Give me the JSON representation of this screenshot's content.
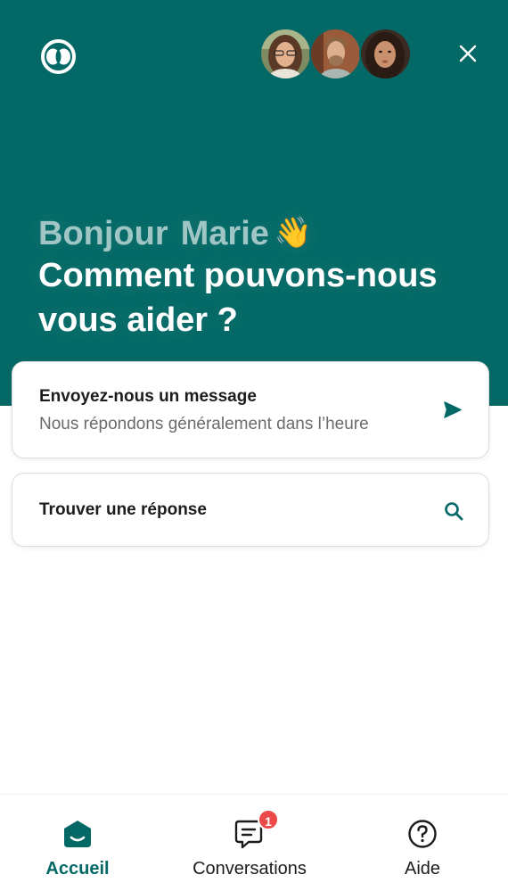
{
  "colors": {
    "brand": "#046966",
    "greeting": "#9fc6c4",
    "badge": "#ec4949"
  },
  "header": {
    "logo_icon": "brand-logo-icon",
    "avatars": [
      "avatar-agent-1",
      "avatar-agent-2",
      "avatar-agent-3"
    ],
    "close_icon": "close-icon"
  },
  "hero": {
    "greeting_prefix": "Bonjour",
    "user_name": "Marie",
    "wave_emoji": "👋",
    "question": "Comment pouvons-nous vous aider ?"
  },
  "cards": {
    "message": {
      "title": "Envoyez-nous un message",
      "subtitle": "Nous répondons généralement dans l’heure",
      "icon": "send-icon"
    },
    "search": {
      "title": "Trouver une réponse",
      "icon": "search-icon"
    }
  },
  "tabs": [
    {
      "label": "Accueil",
      "icon": "home-icon",
      "active": true
    },
    {
      "label": "Conversations",
      "icon": "chat-icon",
      "badge": "1"
    },
    {
      "label": "Aide",
      "icon": "help-icon"
    }
  ]
}
